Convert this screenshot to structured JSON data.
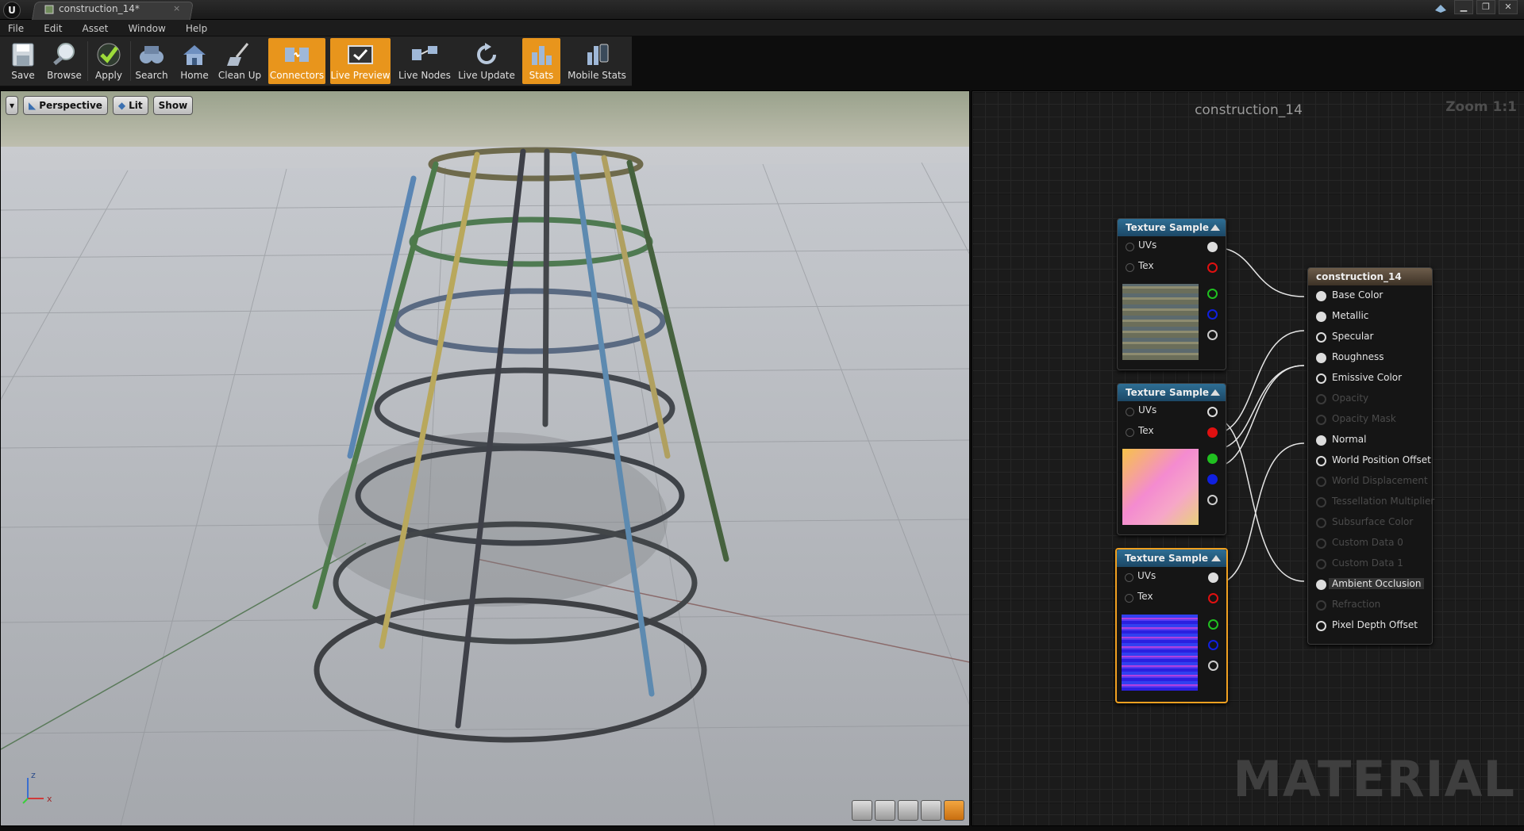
{
  "window": {
    "tab_title": "construction_14*",
    "tab_close": "×",
    "controls": [
      "▁",
      "❐",
      "✕"
    ]
  },
  "menu": [
    "File",
    "Edit",
    "Asset",
    "Window",
    "Help"
  ],
  "toolbar": {
    "save": "Save",
    "browse": "Browse",
    "apply": "Apply",
    "search": "Search",
    "home": "Home",
    "clean_up": "Clean Up",
    "connectors": "Connectors",
    "live_preview": "Live Preview",
    "live_nodes": "Live Nodes",
    "live_update": "Live Update",
    "stats": "Stats",
    "mobile_stats": "Mobile Stats"
  },
  "viewport": {
    "perspective": "Perspective",
    "lit": "Lit",
    "show": "Show",
    "axis_x": "x",
    "axis_z": "z"
  },
  "graph": {
    "title": "construction_14",
    "zoom": "Zoom 1:1",
    "watermark": "MATERIAL",
    "texture_nodes": [
      {
        "title": "Texture Sample",
        "uvs": "UVs",
        "tex": "Tex"
      },
      {
        "title": "Texture Sample",
        "uvs": "UVs",
        "tex": "Tex"
      },
      {
        "title": "Texture Sample",
        "uvs": "UVs",
        "tex": "Tex"
      }
    ],
    "result_node": {
      "title": "construction_14",
      "inputs": [
        "Base Color",
        "Metallic",
        "Specular",
        "Roughness",
        "Emissive Color",
        "Opacity",
        "Opacity Mask",
        "Normal",
        "World Position Offset",
        "World Displacement",
        "Tessellation Multiplier",
        "Subsurface Color",
        "Custom Data 0",
        "Custom Data 1",
        "Ambient Occlusion",
        "Refraction",
        "Pixel Depth Offset"
      ]
    },
    "pin_colors": {
      "white": "#dddddd",
      "red": "#e01010",
      "green": "#20c020",
      "blue": "#1020e0",
      "alpha": "#cccccc"
    }
  },
  "colors": {
    "accent": "#e8951c",
    "node_header": "#2e6e94",
    "selected": "#f0a020"
  }
}
